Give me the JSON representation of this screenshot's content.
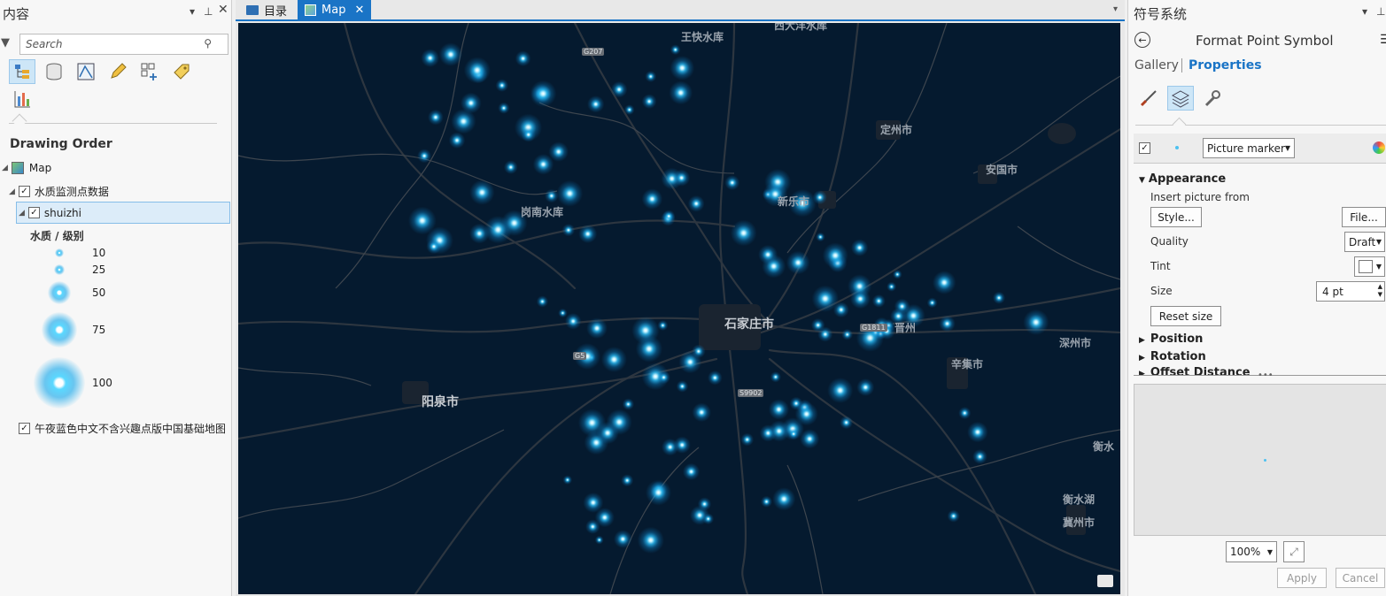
{
  "contents": {
    "title": "内容",
    "search_placeholder": "Search",
    "section_title": "Drawing Order",
    "map_label": "Map",
    "layer_group": "水质监测点数据",
    "layer": "shuizhi",
    "legend_title": "水质 / 级别",
    "legend": [
      {
        "label": "10",
        "size": 10
      },
      {
        "label": "25",
        "size": 25
      },
      {
        "label": "50",
        "size": 50
      },
      {
        "label": "75",
        "size": 75
      },
      {
        "label": "100",
        "size": 100
      }
    ],
    "basemap": "午夜蓝色中文不含兴趣点版中国基础地图"
  },
  "tabs": [
    {
      "label": "目录",
      "active": false
    },
    {
      "label": "Map",
      "active": true
    }
  ],
  "map": {
    "places": {
      "shijiazhuang": "石家庄市",
      "yangquan": "阳泉市",
      "dingzhou": "定州市",
      "anguo": "安国市",
      "xinle": "新乐市",
      "shenzhou": "深州市",
      "xinji": "辛集市",
      "gangnan": "岗南水库",
      "wangkuai": "王快水库",
      "xidayang": "西大洋水库",
      "jinzhou": "晋州",
      "hengshui": "衡水",
      "hengshuihu": "衡水湖",
      "jizhou": "冀州市"
    },
    "shields": {
      "g207": "G207",
      "g5": "G5",
      "s9902": "S9902",
      "g1811": "G1811"
    },
    "colors": {
      "background": "#051a2f",
      "point": "#29b6f6"
    }
  },
  "symbology": {
    "title": "符号系统",
    "heading": "Format Point Symbol",
    "tab_gallery": "Gallery",
    "tab_properties": "Properties",
    "layer_type": "Picture marker",
    "appearance": "Appearance",
    "insert_from": "Insert picture from",
    "style_btn": "Style...",
    "file_btn": "File...",
    "quality_label": "Quality",
    "quality_value": "Draft",
    "tint_label": "Tint",
    "size_label": "Size",
    "size_value": "4 pt",
    "reset_size": "Reset size",
    "position": "Position",
    "rotation": "Rotation",
    "offset": "Offset Distance",
    "zoom": "100%",
    "apply": "Apply",
    "cancel": "Cancel"
  }
}
